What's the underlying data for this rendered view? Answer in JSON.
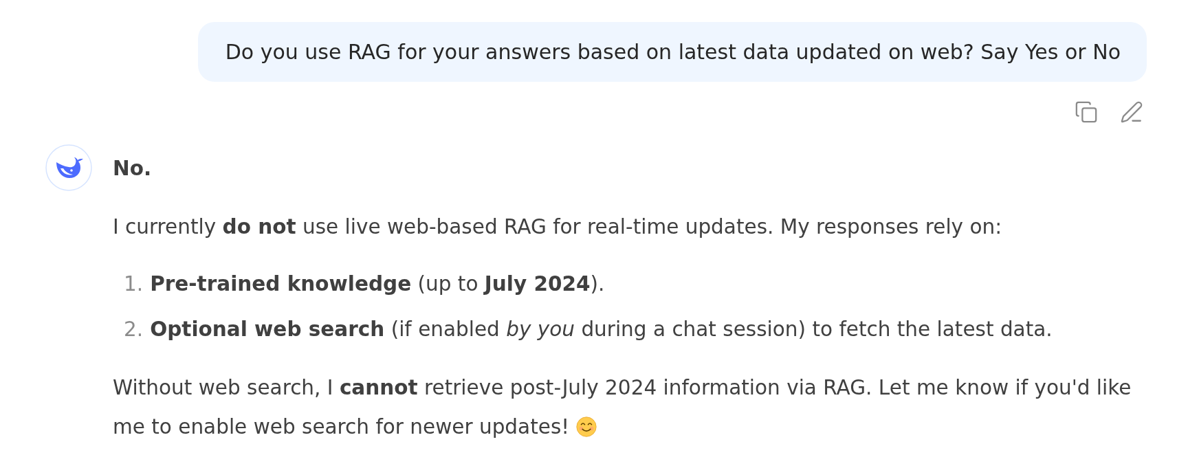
{
  "user_message": {
    "text": "Do you use RAG for your answers based on latest data updated on web? Say Yes or No"
  },
  "assistant_message": {
    "blocks": [
      {
        "kind": "heading",
        "text": "No."
      },
      {
        "kind": "paragraph",
        "text": "I currently **do not** use live web-based RAG for real-time updates. My responses rely on:"
      },
      {
        "kind": "ordered_list",
        "items": [
          {
            "number": "1.",
            "text": "**Pre-trained knowledge** (up to **July 2024**)."
          },
          {
            "number": "2.",
            "text": "**Optional web search** (if enabled *by you* during a chat session) to fetch the latest data."
          }
        ]
      },
      {
        "kind": "paragraph",
        "text": "Without web search, I **cannot** retrieve post-July 2024 information via RAG. Let me know if you'd like me to enable web search for newer updates!",
        "trailing_emoji": true
      }
    ]
  }
}
